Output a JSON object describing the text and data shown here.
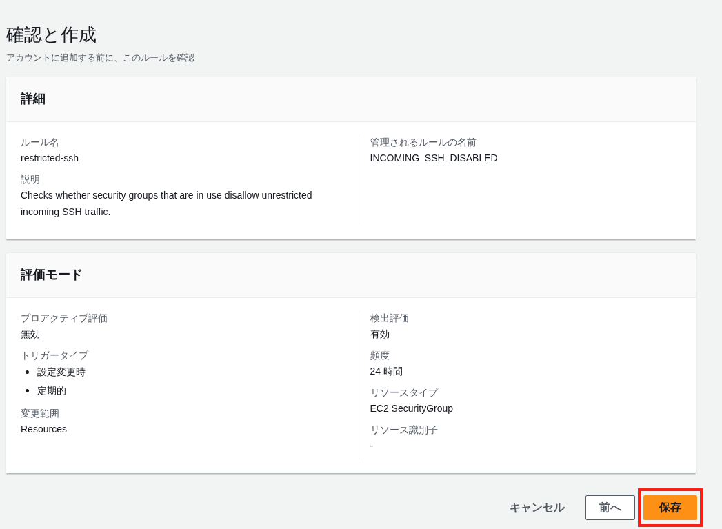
{
  "header": {
    "title": "確認と作成",
    "subtitle": "アカウントに追加する前に、このルールを確認"
  },
  "sections": [
    {
      "title": "詳細",
      "columns": [
        [
          {
            "kind": "text",
            "label": "ルール名",
            "value": "restricted-ssh"
          },
          {
            "kind": "text",
            "label": "説明",
            "value": "Checks whether security groups that are in use disallow unrestricted incoming SSH traffic."
          }
        ],
        [
          {
            "kind": "text",
            "label": "管理されるルールの名前",
            "value": "INCOMING_SSH_DISABLED"
          }
        ]
      ]
    },
    {
      "title": "評価モード",
      "columns": [
        [
          {
            "kind": "text",
            "label": "プロアクティブ評価",
            "value": "無効"
          },
          {
            "kind": "list",
            "label": "トリガータイプ",
            "items": [
              "設定変更時",
              "定期的"
            ]
          },
          {
            "kind": "text",
            "label": "変更範囲",
            "value": "Resources"
          }
        ],
        [
          {
            "kind": "text",
            "label": "検出評価",
            "value": "有効"
          },
          {
            "kind": "text",
            "label": "頻度",
            "value": "24 時間"
          },
          {
            "kind": "text",
            "label": "リソースタイプ",
            "value": "EC2 SecurityGroup"
          },
          {
            "kind": "text",
            "label": "リソース識別子",
            "value": "-"
          }
        ]
      ]
    }
  ],
  "buttons": [
    {
      "kind": "link",
      "label": "キャンセル",
      "highlighted": false
    },
    {
      "kind": "normal",
      "label": "前へ",
      "highlighted": false
    },
    {
      "kind": "primary",
      "label": "保存",
      "highlighted": true
    }
  ]
}
